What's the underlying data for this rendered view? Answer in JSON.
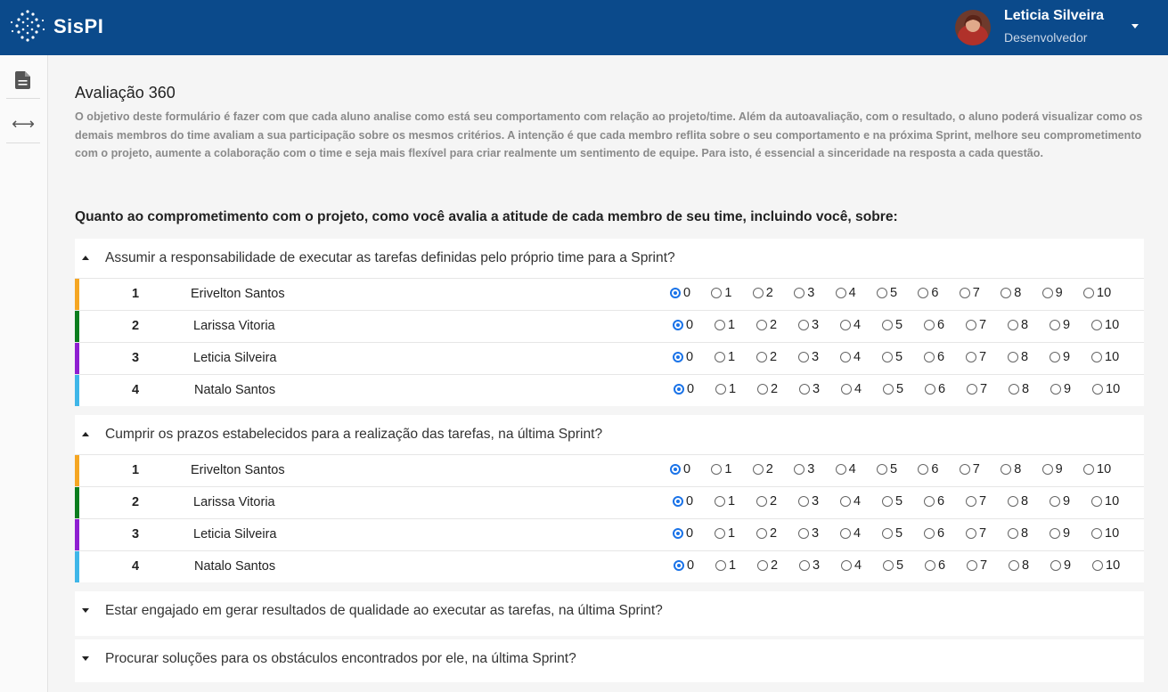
{
  "header": {
    "brand": "SisPI",
    "user_name": "Leticia Silveira",
    "user_role": "Desenvolvedor",
    "bg_color": "#0b4a8b"
  },
  "sidebar": {
    "items": [
      {
        "icon": "document-icon"
      },
      {
        "icon": "expand-horizontal-icon",
        "glyph": "⟷"
      }
    ]
  },
  "page": {
    "title": "Avaliação 360",
    "intro": "O objetivo deste formulário é fazer com que cada aluno analise como está seu comportamento com relação ao projeto/time. Além da autoavaliação, com o resultado, o aluno poderá visualizar como os demais membros do time avaliam a sua participação sobre os mesmos critérios. A intenção é que cada membro reflita sobre o seu comportamento e na próxima Sprint, melhore seu comprometimento com o projeto, aumente a colaboração com o time e seja mais flexível para criar realmente um sentimento de equipe. Para isto, é essencial a sinceridade na resposta a cada questão.",
    "question": "Quanto ao comprometimento com o projeto, como você avalia a atitude de cada membro de seu time, incluindo você, sobre:"
  },
  "scale": [
    "0",
    "1",
    "2",
    "3",
    "4",
    "5",
    "6",
    "7",
    "8",
    "9",
    "10"
  ],
  "members": [
    {
      "num": "1",
      "name": "Erivelton Santos",
      "color": "#f5a623"
    },
    {
      "num": "2",
      "name": "Larissa Vitoria",
      "color": "#0b7d1e"
    },
    {
      "num": "3",
      "name": "Leticia Silveira",
      "color": "#8e1fd1"
    },
    {
      "num": "4",
      "name": "Natalo Santos",
      "color": "#3fb6e8"
    }
  ],
  "criteria": [
    {
      "title": "Assumir a responsabilidade de executar as tarefas definidas pelo próprio time para a Sprint?",
      "expanded": true,
      "selected": [
        0,
        0,
        0,
        0
      ]
    },
    {
      "title": "Cumprir os prazos estabelecidos para a realização das tarefas, na última Sprint?",
      "expanded": true,
      "selected": [
        0,
        0,
        0,
        0
      ]
    },
    {
      "title": "Estar engajado em gerar resultados de qualidade ao executar as tarefas, na última Sprint?",
      "expanded": false
    },
    {
      "title": "Procurar soluções para os obstáculos encontrados por ele, na última Sprint?",
      "expanded": false
    }
  ]
}
